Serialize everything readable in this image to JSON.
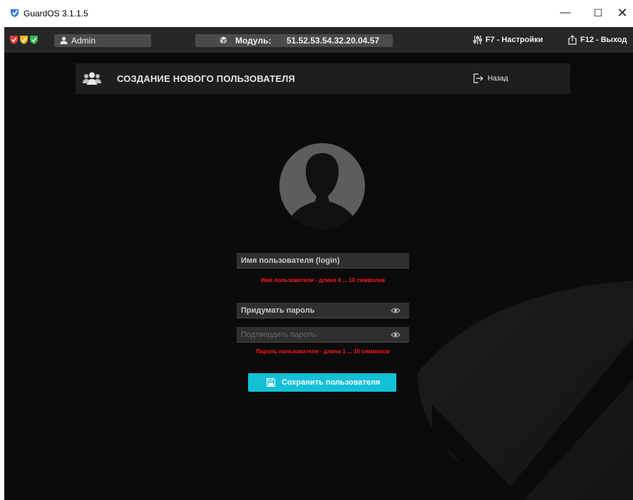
{
  "window": {
    "title": "GuardOS 3.1.1.5",
    "controls": {
      "minimize": "—",
      "maximize": "☐",
      "close": "✕"
    }
  },
  "topbar": {
    "status_shields": [
      {
        "icon": "shield-check-icon",
        "color": "#e23a3a"
      },
      {
        "icon": "shield-check-icon",
        "color": "#e8b21c"
      },
      {
        "icon": "shield-check-icon",
        "color": "#35b54a"
      }
    ],
    "user": {
      "icon": "user-icon",
      "name": "Admin"
    },
    "module": {
      "icon": "cube-icon",
      "label": "Модуль:",
      "value": "51.52.53.54.32.20.04.57"
    },
    "settings": {
      "icon": "sliders-icon",
      "label": "F7 - Настройки"
    },
    "exit": {
      "icon": "share-exit-icon",
      "label": "F12 - Выход"
    }
  },
  "header": {
    "icon": "users-icon",
    "title": "СОЗДАНИЕ НОВОГО ПОЛЬЗОВАТЕЛЯ",
    "back": {
      "icon": "sign-out-icon",
      "label": "Назад"
    }
  },
  "form": {
    "login": {
      "placeholder": "Имя пользователя (login)",
      "value": ""
    },
    "login_error": "Имя пользователя - длина 4 ... 10 символов",
    "password": {
      "placeholder": "Придумать пароль",
      "value": ""
    },
    "confirm": {
      "placeholder": "Подтвердить пароль",
      "value": ""
    },
    "password_error": "Пароль пользователя - длина 1 ... 10 символов",
    "save": {
      "icon": "floppy-disk-icon",
      "label": "Сохранить пользователя"
    }
  },
  "colors": {
    "accent": "#14c0d6",
    "error": "#ff1a1a",
    "background": "#0b0b0c",
    "topbar": "#262728"
  }
}
